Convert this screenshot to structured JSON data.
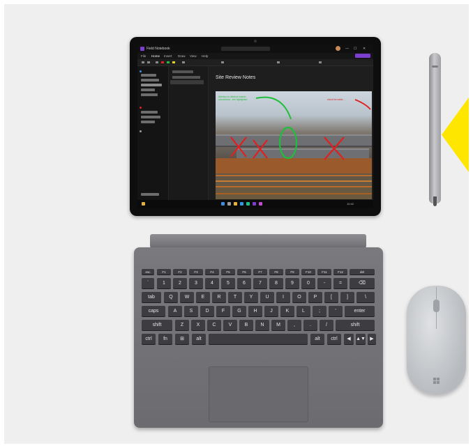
{
  "scene": {
    "description_items": [
      "tablet",
      "pen",
      "keyboard-cover",
      "mouse"
    ]
  },
  "tablet": {
    "app_title": "Field Notebook",
    "ribbon_tabs": [
      "File",
      "Home",
      "Insert",
      "Draw",
      "View",
      "Help"
    ],
    "window_controls": [
      "—",
      "☐",
      "✕"
    ],
    "note_title": "Site Review Notes",
    "annotation_green": "Attention to detail at bracket connections - see highlighted",
    "annotation_red": "check the welds →",
    "taskbar_time": "10:42"
  },
  "keyboard": {
    "fn_row": [
      "esc",
      "F1",
      "F2",
      "F3",
      "F4",
      "F5",
      "F6",
      "F7",
      "F8",
      "F9",
      "F10",
      "F11",
      "F12",
      "del"
    ],
    "number_row": [
      "`",
      "1",
      "2",
      "3",
      "4",
      "5",
      "6",
      "7",
      "8",
      "9",
      "0",
      "-",
      "=",
      "⌫"
    ],
    "top_row": [
      "tab",
      "Q",
      "W",
      "E",
      "R",
      "T",
      "Y",
      "U",
      "I",
      "O",
      "P",
      "[",
      "]",
      "\\"
    ],
    "home_row": [
      "caps",
      "A",
      "S",
      "D",
      "F",
      "G",
      "H",
      "J",
      "K",
      "L",
      ";",
      "'",
      "enter"
    ],
    "bottom_row": [
      "shift",
      "Z",
      "X",
      "C",
      "V",
      "B",
      "N",
      "M",
      ",",
      ".",
      "/",
      "shift"
    ],
    "space_row": [
      "ctrl",
      "fn",
      "⊞",
      "alt",
      "",
      "alt",
      "ctrl",
      "◀",
      "▲▼",
      "▶"
    ]
  },
  "colors": {
    "accent": "#7b3fd0",
    "arrow": "#ffe600",
    "annotation_green": "#1fbf3a",
    "annotation_red": "#e02020"
  }
}
